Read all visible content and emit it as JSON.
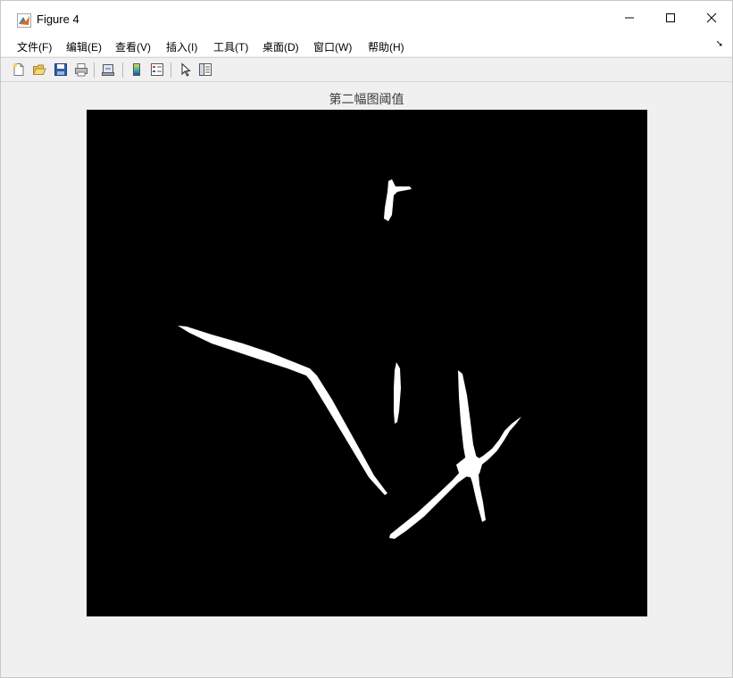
{
  "window": {
    "title": "Figure 4",
    "controls": {
      "minimize": "minimize",
      "maximize": "maximize",
      "close": "close"
    }
  },
  "menu": {
    "items": [
      "文件(F)",
      "编辑(E)",
      "查看(V)",
      "插入(I)",
      "工具(T)",
      "桌面(D)",
      "窗口(W)",
      "帮助(H)"
    ]
  },
  "toolbar": {
    "icons": [
      "new-figure-icon",
      "open-file-icon",
      "save-icon",
      "print-icon",
      "link-plot-icon",
      "colorbar-icon",
      "legend-icon",
      "select-arrow-icon",
      "property-editor-icon"
    ]
  },
  "figure": {
    "title": "第二幅图阈值",
    "image_background": "#000000",
    "foreground": "#ffffff"
  }
}
